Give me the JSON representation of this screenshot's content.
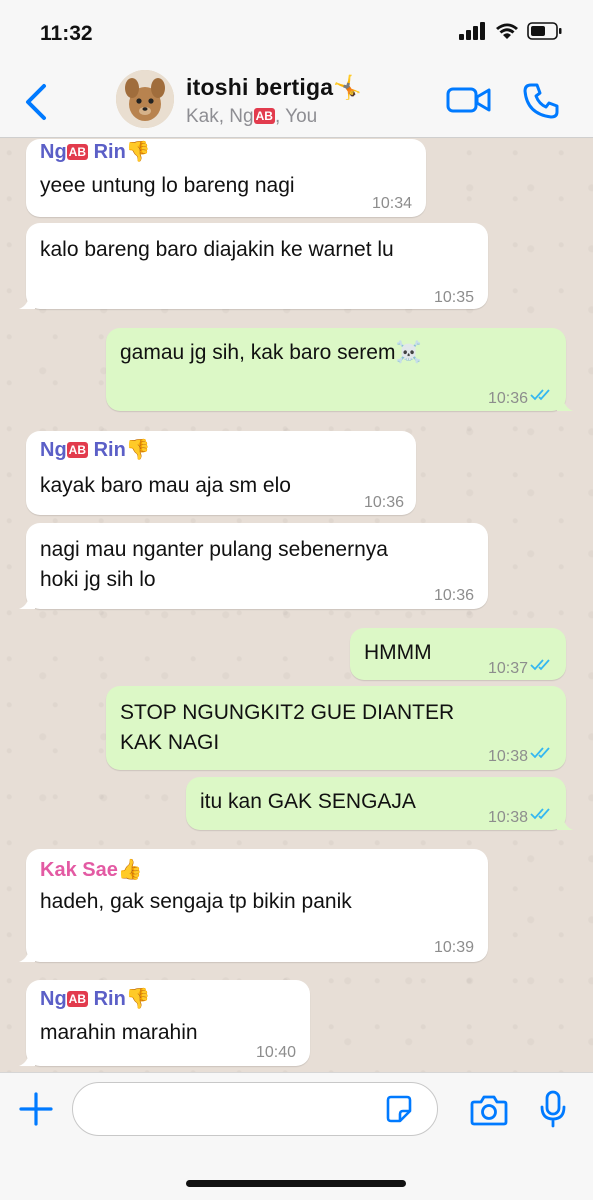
{
  "status_bar": {
    "time": "11:32"
  },
  "header": {
    "title": "itoshi bertiga🤸",
    "subtitle_prefix": "Kak, Ng",
    "ab_emoji": "AB",
    "subtitle_suffix": ", You"
  },
  "messages": [
    {
      "direction": "in",
      "sender_prefix": "Ng",
      "sender_suffix": " Rin👎",
      "lines": [
        "yeee untung lo bareng nagi"
      ],
      "time": "10:34"
    },
    {
      "direction": "in",
      "lines": [
        "kalo bareng baro diajakin ke warnet lu"
      ],
      "time": "10:35"
    },
    {
      "direction": "out",
      "lines": [
        "gamau jg sih, kak baro serem☠️"
      ],
      "time": "10:36"
    },
    {
      "direction": "in",
      "sender_prefix": "Ng",
      "sender_suffix": " Rin👎",
      "lines": [
        "kayak baro mau aja sm elo"
      ],
      "time": "10:36"
    },
    {
      "direction": "in",
      "lines": [
        "nagi mau nganter pulang sebenernya",
        "hoki jg sih lo"
      ],
      "time": "10:36"
    },
    {
      "direction": "out",
      "lines": [
        "HMMM"
      ],
      "time": "10:37"
    },
    {
      "direction": "out",
      "lines": [
        "STOP NGUNGKIT2 GUE DIANTER",
        "KAK NAGI"
      ],
      "time": "10:38"
    },
    {
      "direction": "out",
      "lines": [
        "itu kan GAK SENGAJA"
      ],
      "time": "10:38"
    },
    {
      "direction": "in",
      "sender": "Kak Sae👍",
      "lines": [
        "hadeh, gak sengaja tp bikin panik"
      ],
      "time": "10:39"
    },
    {
      "direction": "in",
      "sender_prefix": "Ng",
      "sender_suffix": " Rin👎",
      "lines": [
        "marahin marahin"
      ],
      "time": "10:40"
    }
  ],
  "composer": {
    "placeholder": ""
  },
  "colors": {
    "accent": "#007aff",
    "outgoing_bubble": "#dcf8c6",
    "incoming_bubble": "#ffffff",
    "read_ticks": "#34b7f1"
  },
  "icons": [
    "back-icon",
    "video-call-icon",
    "phone-icon",
    "plus-icon",
    "sticker-icon",
    "camera-icon",
    "microphone-icon",
    "read-receipt-icon",
    "signal-icon",
    "wifi-icon",
    "battery-icon"
  ]
}
